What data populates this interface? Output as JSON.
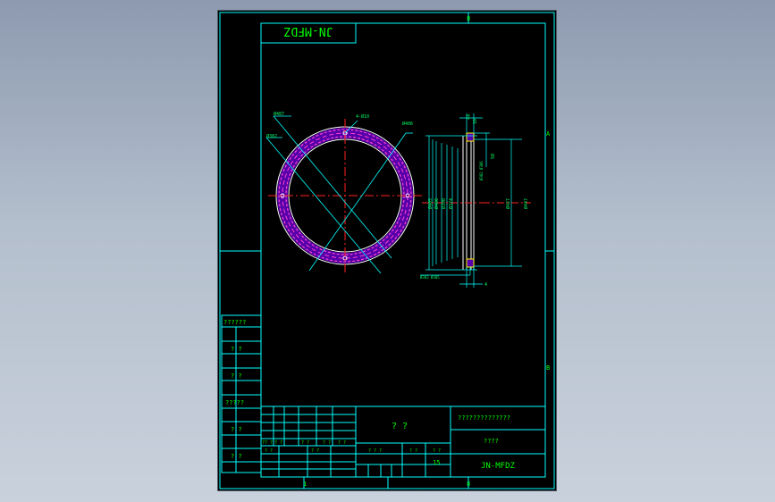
{
  "drawing": {
    "title_mirrored": "JN-MFDZ",
    "zone_letters": [
      "A",
      "B"
    ],
    "zone_numbers": [
      "8",
      "1",
      "8"
    ],
    "side_labels": [
      "??????",
      "? ?",
      "? ?",
      "?????",
      "? ?",
      "? ?"
    ],
    "title_block": {
      "name": "? ?",
      "company": "??????????????",
      "material": "????",
      "code": "JN-MFDZ",
      "scale": "15",
      "mini_labels": [
        "?? ?",
        "? ?",
        "? ?",
        "? ?",
        "? ?",
        "? ?",
        "? ?",
        "? ? ?",
        "? ?",
        "? ?"
      ]
    },
    "annotations": {
      "front": [
        "Ø487",
        "Ø382",
        "4-Ø10",
        "Ø406"
      ],
      "side": [
        "10",
        "44",
        "50",
        "Ø447",
        "Ø427",
        "Ø405",
        "Ø400",
        "Ø390",
        "Ø374",
        "4",
        "Ø382 Ø386",
        "Ø383 Ø385"
      ]
    },
    "colors": {
      "frame": "#00ffff",
      "text": "#00ff00",
      "annotation": "#00ff66",
      "centerline": "#ff2222",
      "pink": "#ff44cc",
      "purple": "#5500aa",
      "highlight": "#ffff00"
    }
  }
}
